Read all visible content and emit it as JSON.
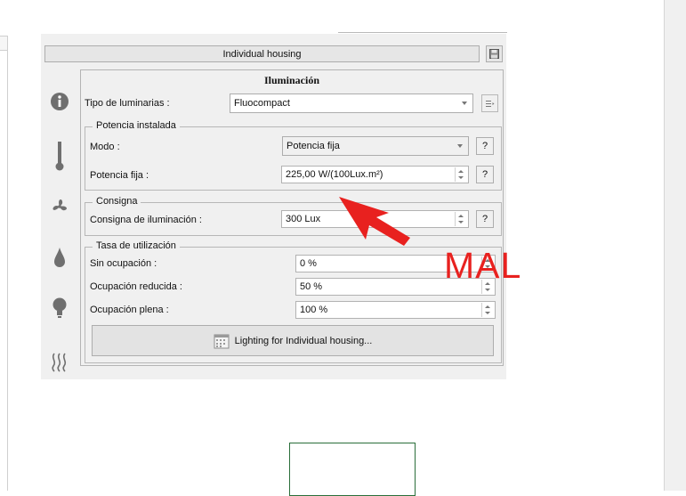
{
  "window": {
    "title": "Individual housing"
  },
  "panel": {
    "heading": "Iluminación",
    "tipo_label": "Tipo de luminarias :",
    "tipo_value": "Fluocompact"
  },
  "potencia": {
    "group_title": "Potencia instalada",
    "modo_label": "Modo :",
    "modo_value": "Potencia fija",
    "fija_label": "Potencia fija :",
    "fija_value": "225,00 W/(100Lux.m²)"
  },
  "consigna": {
    "group_title": "Consigna",
    "label": "Consigna de iluminación :",
    "value": "300 Lux"
  },
  "tasa": {
    "group_title": "Tasa de utilización",
    "rows": [
      {
        "label": "Sin ocupación :",
        "value": "0 %"
      },
      {
        "label": "Ocupación reducida :",
        "value": "50 %"
      },
      {
        "label": "Ocupación plena :",
        "value": "100 %"
      }
    ]
  },
  "help_label": "?",
  "lighting_button_label": "Lighting for Individual housing...",
  "annotation": {
    "text": "MAL",
    "color": "#e8211f"
  },
  "sidebar_icons": [
    "info-icon",
    "thermometer-icon",
    "fan-icon",
    "water-drop-icon",
    "lightbulb-icon",
    "heat-waves-icon"
  ]
}
